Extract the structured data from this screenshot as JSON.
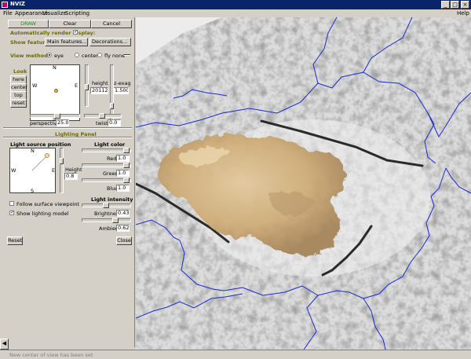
{
  "window": {
    "title": "NVIZ",
    "minimize": "_",
    "maximize": "□",
    "close": "×"
  },
  "menu": {
    "file": "File",
    "appearance": "Appearance",
    "visualize": "Visualize",
    "scripting": "Scripting",
    "help": "Help"
  },
  "toolbar": {
    "draw": "DRAW",
    "clear": "Clear",
    "cancel": "Cancel"
  },
  "render": {
    "auto_label": "Automatically render display:",
    "auto_checked": "✓"
  },
  "features": {
    "label": "Show features:",
    "main": "Main features...",
    "decorations": "Decorations..."
  },
  "view": {
    "method_label": "View method:",
    "eye": "eye",
    "center": "center",
    "fly": "fly none",
    "look_label": "Look",
    "here": "here",
    "center_btn": "center",
    "top": "top",
    "reset": "reset",
    "compass_n": "N",
    "compass_w": "W",
    "compass_e": "E",
    "compass_s": "S",
    "height_label": "height",
    "height_value": "20112",
    "zexag_label": "z-exag",
    "zexag_value": "1.500",
    "perspective_label": "perspective",
    "perspective_value": "25.0",
    "twist_label": "twist",
    "twist_value": "0.0"
  },
  "lighting": {
    "panel_title": "Lighting Panel",
    "source_label": "Light source position",
    "compass_n": "N",
    "compass_w": "W",
    "compass_e": "E",
    "compass_s": "S",
    "height_label": "Height",
    "height_value": "0.8",
    "color_label": "Light color",
    "red_label": "Red",
    "red_value": "1.0",
    "green_label": "Green",
    "green_value": "1.0",
    "blue_label": "Blue",
    "blue_value": "1.0",
    "intensity_label": "Light intensity",
    "brightness_label": "Brightness",
    "brightness_value": "0.43",
    "ambient_label": "Ambient",
    "ambient_value": "0.62",
    "follow_label": "Follow surface viewpoint",
    "show_model_label": "Show lighting model",
    "show_model_checked": "✓",
    "reset": "Reset",
    "close": "Close"
  },
  "status": {
    "message": "New center of view has been set"
  },
  "colors": {
    "titlebar": "#0a246a",
    "panel": "#d4d0c8",
    "vector": "#1a2acc",
    "olive_label": "#6b6b00"
  }
}
